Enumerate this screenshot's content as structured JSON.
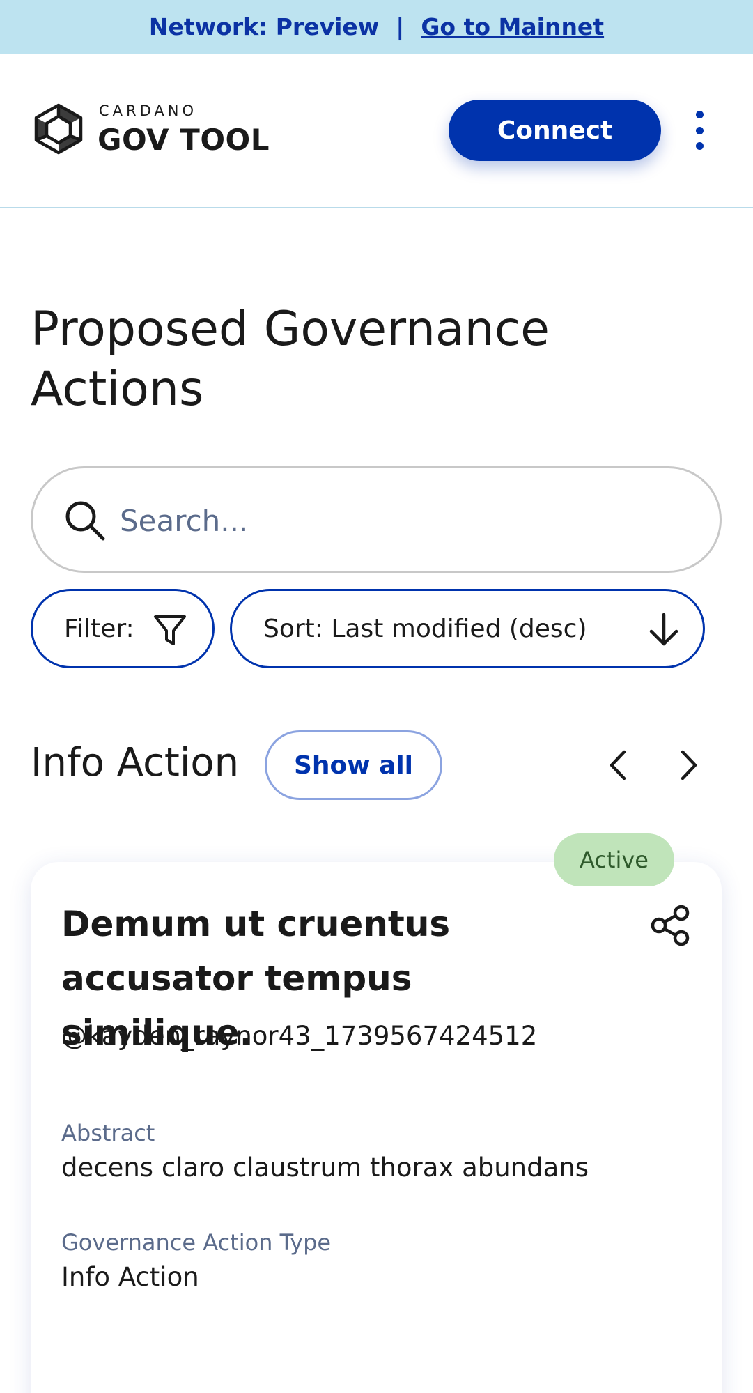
{
  "banner": {
    "network_text": "Network: Preview",
    "separator": "|",
    "mainnet_link": "Go to Mainnet"
  },
  "header": {
    "logo_brand": "CARDANO",
    "logo_name": "GOV TOOL",
    "connect_label": "Connect",
    "menu_icon": "vertical-dots-icon"
  },
  "main": {
    "title": "Proposed Governance Actions",
    "search_placeholder": "Search...",
    "search_value": "",
    "filter_label": "Filter:",
    "sort_label": "Sort: Last modified (desc)"
  },
  "section": {
    "title": "Info Action",
    "show_all_label": "Show all"
  },
  "card": {
    "status": "Active",
    "title": "Demum ut cruentus accusator tempus similique.",
    "author": "@kayden_raynor43_1739567424512",
    "abstract_label": "Abstract",
    "abstract_value": "decens claro claustrum thorax abundans",
    "type_label": "Governance Action Type",
    "type_value": "Info Action"
  },
  "colors": {
    "primary": "#0033ad",
    "banner_bg": "#bde3f0",
    "status_bg": "#c0e4ba",
    "status_text": "#2f5a2c",
    "label_text": "#5b6b8b"
  }
}
